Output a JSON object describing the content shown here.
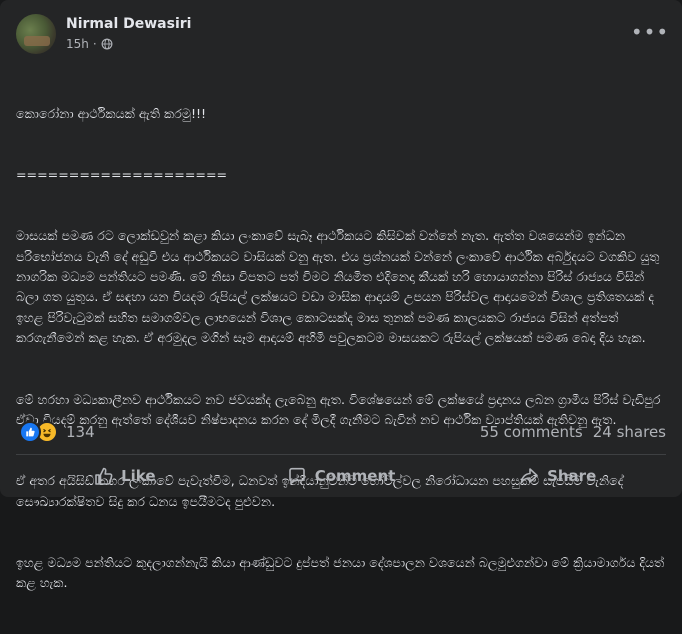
{
  "post": {
    "author": "Nirmal Dewasiri",
    "time": "15h",
    "separator": "·",
    "privacy_icon": "globe-icon",
    "more_icon": "more-options-icon",
    "text_lines": [
      "කොරෝනා ආර්ථිකයක් ඇති කරමු!!!",
      "====================",
      "මාසයක් පමණ රට ලොක්ඩවුන් කළා කියා ලංකාවේ සැබෑ ආර්ථිකයට කිසිවක් වන්නේ නැත. ඇත්ත වශයෙන්ම ඉන්ධන පරිභෝජනය වැනි දේ අඩුවී එය ආර්ථිකයට වාසියක් වනු ඇත. එය ප්‍රශ්නයක් වන්නේ ලංකාවේ ආර්ථික අර්බුදයට වගකිව යුතු නාගරික මධ්‍යම පන්තියට පමණි. මේ නිසා විපතට පත් විමට නියමිත එදිනෙදා කීයක් හරි හොයාගන්නා පිරිස් රාජ්‍යය විසින් බලා ගත යුතුය. ඒ සඳහා යන වියදම රුපියල් ලක්ෂයට වඩා මාසික ආදායම් උපයන පිරිස්වල ආදායමෙන් විශාල ප්‍රතිශතයක් ද ඉහළ පිරිවැටුමක් සහිත සමාගම්වල ලාභයෙන් විශාල කොටසක්ද මාස තුනක් පමණ කාලයකට රාජ්‍යය විසින් අත්පත් කරගැනීමෙන් කළ හැක. ඒ අරමුදල මගින් සෑම ආදායම් අහිමි පවුලකටම මාසයකට රුපියල් ලක්ෂයක් පමණ බෙදා දිය හැක.",
      "මේ හරහා මධ්‍යකාලීනව ආර්ථිකයට නව ජවයක්ද ලැබෙනු ඇත. විශේෂයෙන් මේ ලක්ෂයේ ප්‍රදානය ලබන ග්‍රාමීය පිරිස් වැඩිපුර ඒවා වියදම් කරනු ඇත්තේ දේශීයව නිෂ්පාදනය කරන දේ මිලදී ගැනීමට බැවින් නව ආර්ථික ව්‍යාප්තියක් ඇතිවනු ඇත.",
      "ඒ අතර අයිසිඩ් නගර ලංකාවේ පැවැත්වීම, ධනවත් ඉන්දියානුවන්ට හෝටල්වල නිරෝධායන පහසුකම් සැපයීම වැනිදේ සෞඛ්‍යාරක්ෂිතව සිදු කර ධනය ඉපයීමටද පුළුවන.",
      "ඉහළ මධ්‍යම පන්තියට කුදලාගන්නැයි කියා ආණ්ඩුවට දුප්පත් ජනයා දේශපාලන වශයෙන් බලමුළුගන්වා මේ ක්‍රියාමාර්ගය දියත් කළ හැක."
    ]
  },
  "stats": {
    "reaction_count": "134",
    "comments": "55 comments",
    "shares": "24 shares",
    "reaction_icons": [
      "like-reaction-icon",
      "haha-reaction-icon"
    ]
  },
  "actions": {
    "like": "Like",
    "comment": "Comment",
    "share": "Share"
  },
  "colors": {
    "background": "#18191a",
    "card": "#242526",
    "text_primary": "#e4e6eb",
    "text_secondary": "#b0b3b8",
    "like_blue": "#1877f2",
    "haha_yellow": "#f7b928",
    "divider": "#3e4042"
  }
}
